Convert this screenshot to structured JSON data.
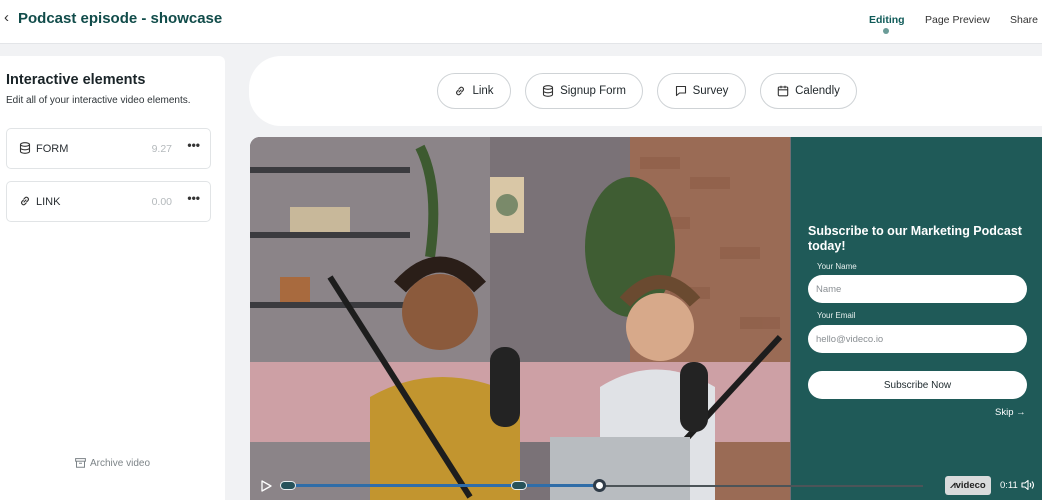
{
  "header": {
    "back_glyph": "‹",
    "title": "Podcast episode - showcase",
    "tabs": [
      {
        "label": "Editing",
        "active": true
      },
      {
        "label": "Page Preview",
        "active": false
      },
      {
        "label": "Share",
        "active": false
      }
    ]
  },
  "sidebar": {
    "title": "Interactive elements",
    "subtitle": "Edit all of your interactive video elements.",
    "items": [
      {
        "label": "FORM",
        "time": "9.27",
        "icon": "database-icon"
      },
      {
        "label": "LINK",
        "time": "0.00",
        "icon": "link-icon"
      }
    ],
    "more_glyph": "•••",
    "archive_label": "Archive video"
  },
  "toolbar": {
    "items": [
      {
        "label": "Link",
        "icon": "link-icon"
      },
      {
        "label": "Signup Form",
        "icon": "database-icon"
      },
      {
        "label": "Survey",
        "icon": "chat-bubble-icon"
      },
      {
        "label": "Calendly",
        "icon": "calendar-icon"
      }
    ]
  },
  "overlay": {
    "title": "Subscribe to our Marketing Podcast today!",
    "name_label": "Your Name",
    "name_placeholder": "Name",
    "email_label": "Your Email",
    "email_placeholder": "hello@videco.io",
    "submit_label": "Subscribe Now",
    "skip_label": "Skip →"
  },
  "player": {
    "brand": "⩘videco",
    "timecode": "0:11",
    "progress": 0.496
  },
  "colors": {
    "brand_dark": "#114c4a",
    "overlay_bg": "#1f5a58",
    "progress_fill": "#2f6da8"
  }
}
